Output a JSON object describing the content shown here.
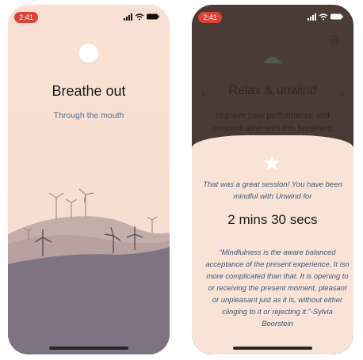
{
  "left_screen": {
    "status_time": "2:41",
    "title": "Breathe out",
    "subtitle": "Through the mouth"
  },
  "right_screen": {
    "status_time": "2:41",
    "title": "Relax & unwind",
    "description": "Improve your performance and concentration with this breathing",
    "completion_message": "That was a great session! You have been mindful with Unwind for",
    "duration": "2 mins 30 secs",
    "quote": "“Mindfulness is the aware balanced\nacceptance of the present experience. It isn\nmore complicated than that. It is opening to\nor receiving the present moment, pleasant\nor unpleasant just as it is, without either\nclinging to it or rejecting it.”-Sylvia\nBoorstein"
  },
  "icons": {
    "signal": "signal-icon",
    "wifi": "wifi-icon",
    "battery": "battery-icon",
    "moon": "moon-icon",
    "star": "star-icon",
    "gear": "gear-icon"
  },
  "colors": {
    "background_peach": "#f8e1d4",
    "time_pill": "#e0413a",
    "hill_light": "#c4aeaa",
    "hill_dark": "#7d7382",
    "subtitle_blue": "#5a7399",
    "overlay_dark": "#4a3b36"
  }
}
